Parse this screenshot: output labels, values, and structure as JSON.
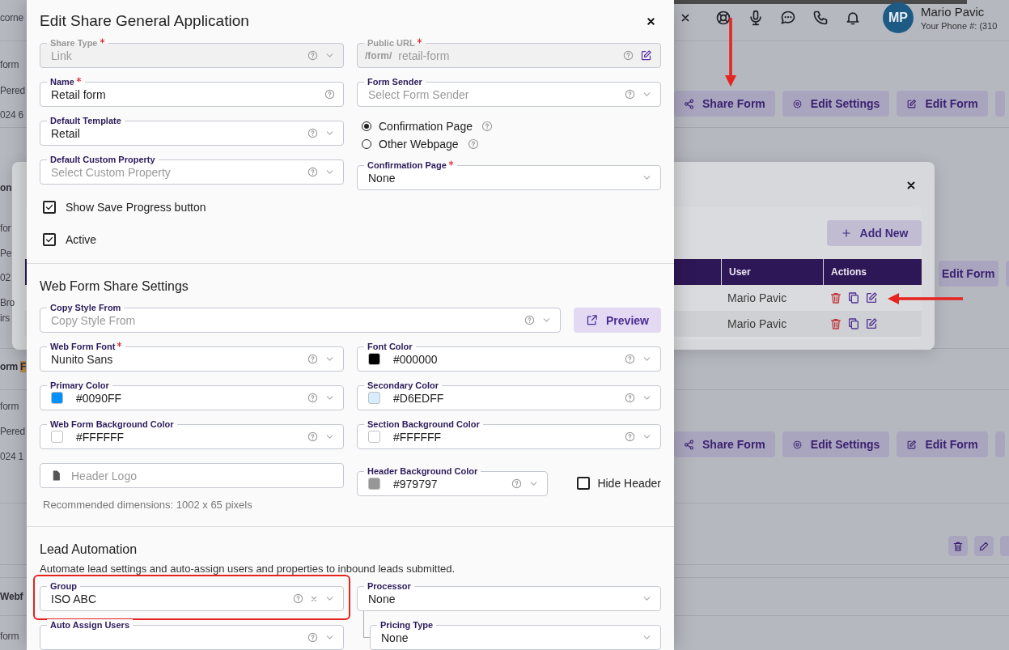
{
  "background_page": {
    "left_edge": [
      {
        "text": "corne",
        "bold": false
      },
      {
        "text": "form",
        "bold": false
      },
      {
        "text": "Pered",
        "bold": false
      },
      {
        "text": "024 6",
        "bold": false
      },
      {
        "text": "on",
        "bold": true
      },
      {
        "text": "for",
        "bold": false
      },
      {
        "text": "Pe",
        "bold": false
      },
      {
        "text": "02",
        "bold": false
      },
      {
        "text": "Bro",
        "bold": false
      },
      {
        "text": "irs",
        "bold": false
      },
      {
        "text": "orm",
        "bold": true,
        "highlight": "F"
      },
      {
        "text": "form",
        "bold": false
      },
      {
        "text": "Pered",
        "bold": false
      },
      {
        "text": "024 1",
        "bold": false
      },
      {
        "text": "Webf",
        "bold": true
      },
      {
        "text": "form",
        "bold": false
      }
    ],
    "user": {
      "initials": "MP",
      "name": "Mario Pavic",
      "phone": "Your Phone #: (310"
    },
    "form_rows": [
      {
        "buttons": [
          {
            "label": "Share Form",
            "kind": "share"
          },
          {
            "label": "Edit Settings",
            "kind": "settings"
          },
          {
            "label": "Edit Form",
            "kind": "edit"
          }
        ]
      },
      {
        "buttons": [
          {
            "label": "Share Form",
            "kind": "share"
          },
          {
            "label": "Edit Settings",
            "kind": "settings"
          },
          {
            "label": "Edit Form",
            "kind": "edit"
          }
        ]
      }
    ],
    "middle_button": "Edit Form",
    "dialog": {
      "add_button": "Add New",
      "columns": [
        "User",
        "Actions"
      ],
      "rows": [
        {
          "user": "Mario Pavic"
        },
        {
          "user": "Mario Pavic"
        }
      ]
    }
  },
  "modal": {
    "title": "Edit Share General Application",
    "general": {
      "left": [
        {
          "label": "Share Type",
          "required": true,
          "kind": "select",
          "value": "Link",
          "help": true,
          "disabled": true
        },
        {
          "label": "Name",
          "required": true,
          "kind": "text",
          "value": "Retail form",
          "help": true,
          "disabled": false
        },
        {
          "label": "Default Template",
          "required": false,
          "kind": "select",
          "value": "Retail",
          "help": true,
          "disabled": false
        },
        {
          "label": "Default Custom Property",
          "required": false,
          "kind": "select",
          "placeholder": "Select Custom Property",
          "help": true,
          "disabled": false
        }
      ],
      "right": [
        {
          "label": "Public URL",
          "required": true,
          "kind": "url",
          "prefix": "/form/",
          "value": "retail-form",
          "help": true,
          "disabled": true
        },
        {
          "label": "Form Sender",
          "required": false,
          "kind": "select",
          "placeholder": "Select Form Sender",
          "help": true,
          "disabled": false
        },
        {
          "kind": "radio-group",
          "options": [
            {
              "label": "Confirmation Page",
              "selected": true,
              "help": true
            },
            {
              "label": "Other Webpage",
              "selected": false,
              "help": true
            }
          ]
        },
        {
          "label": "Confirmation Page",
          "required": true,
          "kind": "select",
          "value": "None",
          "help": false,
          "disabled": false
        }
      ]
    },
    "checkboxes": [
      {
        "label": "Show Save Progress button",
        "checked": true
      },
      {
        "label": "Active",
        "checked": true
      }
    ],
    "web_form": {
      "title": "Web Form Share Settings",
      "copy_style": {
        "label": "Copy Style From",
        "required": false,
        "kind": "select",
        "placeholder": "Copy Style From",
        "help": true
      },
      "preview_button": "Preview",
      "fields": [
        {
          "label": "Web Form Font",
          "required": true,
          "kind": "select",
          "value": "Nunito Sans",
          "help": true
        },
        {
          "label": "Font Color",
          "required": false,
          "kind": "color",
          "color": "#000000",
          "value": "#000000",
          "help": true
        },
        {
          "label": "Primary Color",
          "required": false,
          "kind": "color",
          "color": "#0090ff",
          "value": "#0090FF",
          "help": true
        },
        {
          "label": "Secondary Color",
          "required": false,
          "kind": "color",
          "color": "#d6edff",
          "value": "#D6EDFF",
          "help": true
        },
        {
          "label": "Web Form Background Color",
          "required": false,
          "kind": "color",
          "color": "#ffffff",
          "value": "#FFFFFF",
          "help": true
        },
        {
          "label": "Section Background Color",
          "required": false,
          "kind": "color",
          "color": "#ffffff",
          "value": "#FFFFFF",
          "help": true
        }
      ],
      "header_logo": {
        "kind": "file",
        "placeholder": "Header Logo"
      },
      "header_background": {
        "label": "Header Background Color",
        "required": false,
        "kind": "color",
        "color": "#979797",
        "value": "#979797",
        "help": true
      },
      "hide_header": {
        "label": "Hide Header",
        "checked": false
      },
      "note": "Recommended dimensions: 1002 x 65 pixels"
    },
    "lead_automation": {
      "title": "Lead Automation",
      "description": "Automate lead settings and auto-assign users and properties to inbound leads submitted.",
      "left": [
        {
          "label": "Group",
          "required": false,
          "kind": "select",
          "value": "ISO ABC",
          "help": true,
          "clearable": true,
          "highlighted": true
        },
        {
          "label": "Auto Assign Users",
          "required": false,
          "kind": "select",
          "help": true,
          "highlighted": false
        }
      ],
      "right": [
        {
          "label": "Processor",
          "required": false,
          "kind": "select",
          "value": "None",
          "help": false,
          "children": [
            {
              "label": "Pricing Type",
              "required": false,
              "kind": "select",
              "value": "None",
              "help": false
            }
          ]
        }
      ]
    }
  }
}
